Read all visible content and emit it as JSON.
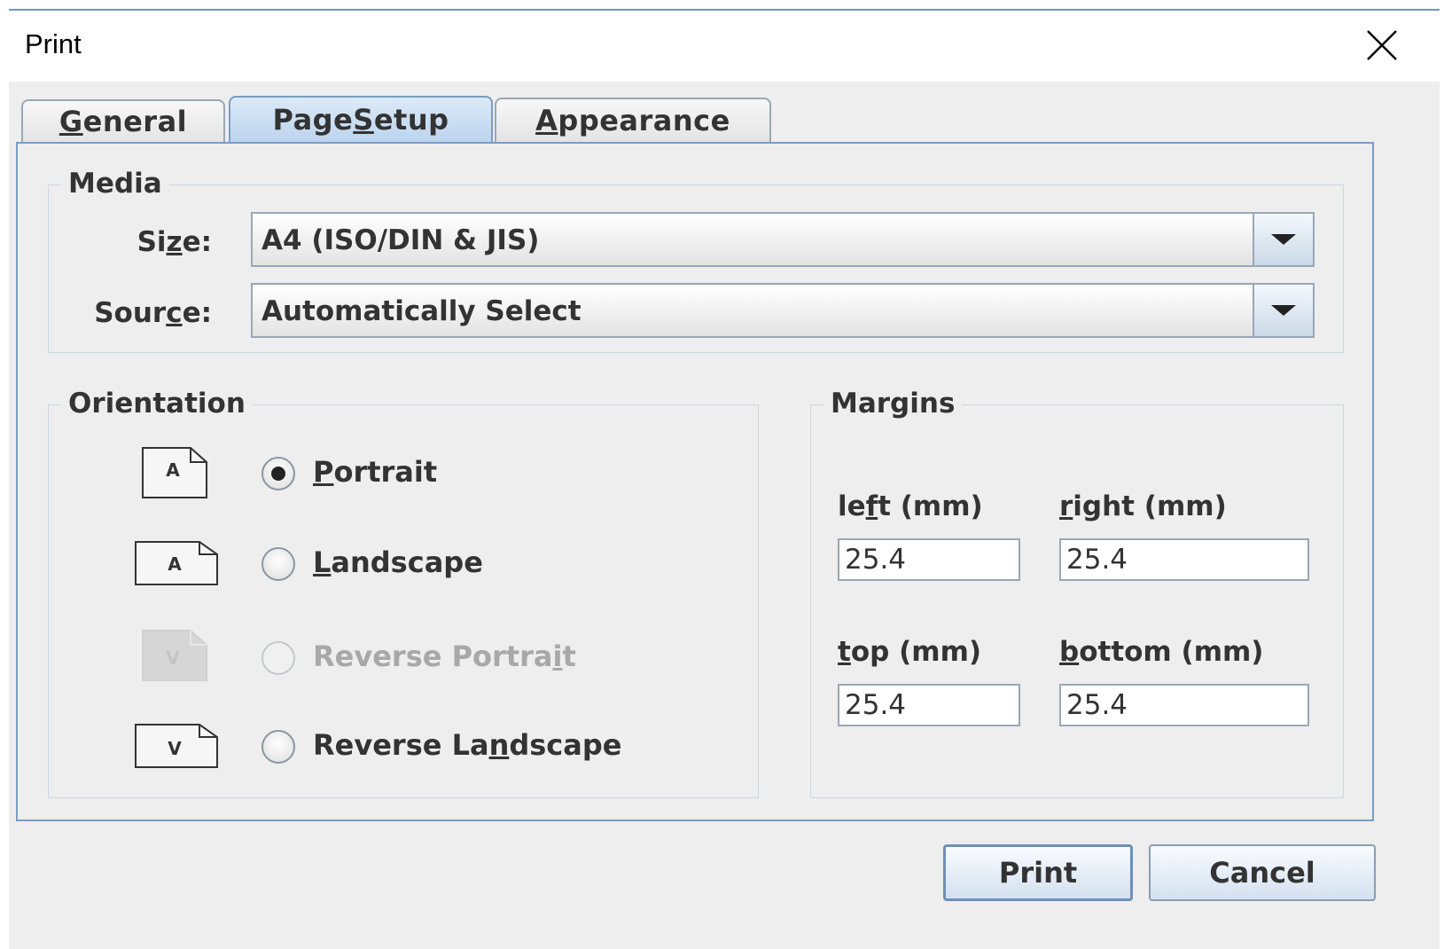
{
  "window": {
    "title": "Print"
  },
  "tabs": [
    {
      "label_pre": "",
      "label_mn": "G",
      "label_post": "eneral",
      "active": false
    },
    {
      "label_pre": "Page ",
      "label_mn": "S",
      "label_post": "etup",
      "active": true
    },
    {
      "label_pre": "",
      "label_mn": "A",
      "label_post": "ppearance",
      "active": false
    }
  ],
  "media": {
    "title": "Media",
    "size_label_pre": "Si",
    "size_label_mn": "z",
    "size_label_post": "e:",
    "size_value": "A4 (ISO/DIN & JIS)",
    "source_label_pre": "Sour",
    "source_label_mn": "c",
    "source_label_post": "e:",
    "source_value": "Automatically Select"
  },
  "orientation": {
    "title": "Orientation",
    "options": [
      {
        "pre": "",
        "mn": "P",
        "post": "ortrait",
        "glyph": "A",
        "checked": true,
        "disabled": false
      },
      {
        "pre": "",
        "mn": "L",
        "post": "andscape",
        "glyph": "A",
        "checked": false,
        "disabled": false
      },
      {
        "pre": "Reverse Portra",
        "mn": "i",
        "post": "t",
        "glyph": "V",
        "checked": false,
        "disabled": true
      },
      {
        "pre": "Reverse La",
        "mn": "n",
        "post": "dscape",
        "glyph": "V",
        "checked": false,
        "disabled": false
      }
    ]
  },
  "margins": {
    "title": "Margins",
    "left_label_pre": "le",
    "left_label_mn": "f",
    "left_label_post": "t (mm)",
    "left_value": "25.4",
    "right_label_pre": "",
    "right_label_mn": "r",
    "right_label_post": "ight (mm)",
    "right_value": "25.4",
    "top_label_pre": "",
    "top_label_mn": "t",
    "top_label_post": "op (mm)",
    "top_value": "25.4",
    "bottom_label_pre": "",
    "bottom_label_mn": "b",
    "bottom_label_post": "ottom (mm)",
    "bottom_value": "25.4"
  },
  "buttons": {
    "print": "Print",
    "cancel": "Cancel"
  }
}
